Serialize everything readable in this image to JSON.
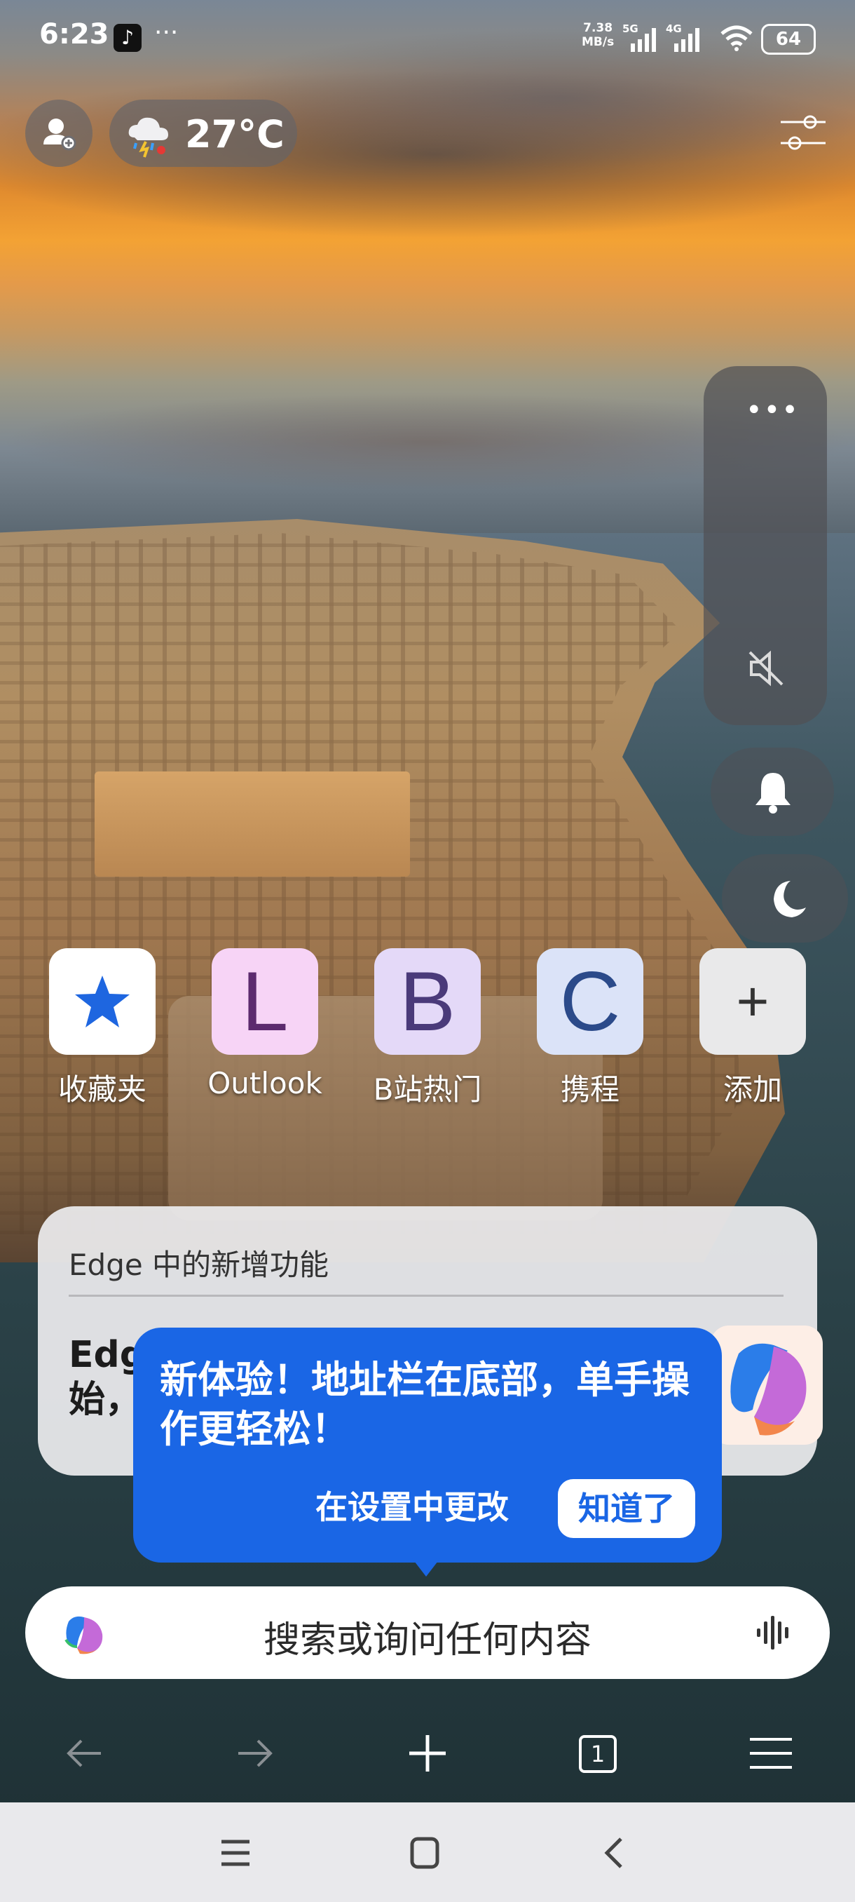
{
  "status_bar": {
    "time": "6:23",
    "more_dots": "···",
    "net_speed_value": "7.38",
    "net_speed_unit": "MB/s",
    "sim1_type": "5G",
    "sim2_type": "4G",
    "battery": "64"
  },
  "header": {
    "weather_temp": "27°C"
  },
  "side_panel": {
    "more_label": "•••"
  },
  "quick_links": [
    {
      "label": "收藏夹",
      "letter": "",
      "color": "#ffffff"
    },
    {
      "label": "Outlook",
      "letter": "L",
      "color": "#f7d4f6"
    },
    {
      "label": "B站热门",
      "letter": "B",
      "color": "#e4d9f8"
    },
    {
      "label": "携程",
      "letter": "C",
      "color": "#dbe3f8"
    },
    {
      "label": "添加",
      "letter": "+",
      "color": "#e9e9ea"
    }
  ],
  "news_card": {
    "title": "Edge 中的新增功能",
    "text_line1": "Edg",
    "text_line2": "始，"
  },
  "tooltip": {
    "message": "新体验！地址栏在底部，单手操作更轻松！",
    "change_label": "在设置中更改",
    "ok_label": "知道了"
  },
  "search": {
    "placeholder": "搜索或询问任何内容"
  },
  "toolbar": {
    "tab_count": "1"
  },
  "colors": {
    "accent": "#1a66e5",
    "star_blue": "#1e66e0",
    "letter_L": "#5c2a6e",
    "letter_B": "#4a3a7a",
    "letter_C": "#2b4a8a"
  }
}
